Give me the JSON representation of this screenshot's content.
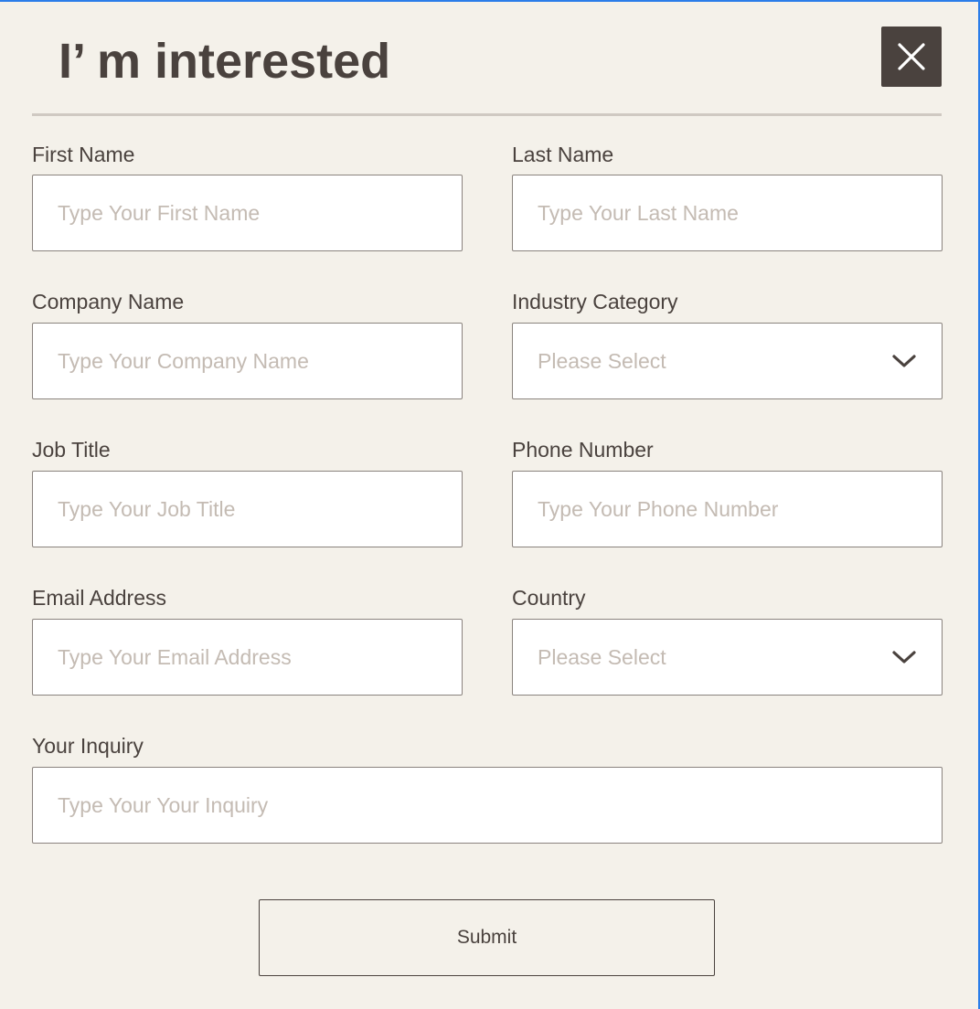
{
  "form": {
    "title": "I’ m interested",
    "close_icon": "close-icon",
    "submit_label": "Submit",
    "fields": {
      "first_name": {
        "label": "First Name",
        "placeholder": "Type Your First Name",
        "value": ""
      },
      "last_name": {
        "label": "Last Name",
        "placeholder": "Type Your Last Name",
        "value": ""
      },
      "company_name": {
        "label": "Company Name",
        "placeholder": "Type Your Company Name",
        "value": ""
      },
      "industry_category": {
        "label": "Industry Category",
        "selected": "Please Select",
        "icon": "chevron-down-icon"
      },
      "job_title": {
        "label": "Job Title",
        "placeholder": "Type Your Job Title",
        "value": ""
      },
      "phone_number": {
        "label": "Phone Number",
        "placeholder": "Type Your Phone Number",
        "value": ""
      },
      "email_address": {
        "label": "Email Address",
        "placeholder": "Type Your Email Address",
        "value": ""
      },
      "country": {
        "label": "Country",
        "selected": "Please Select",
        "icon": "chevron-down-icon"
      },
      "your_inquiry": {
        "label": "Your Inquiry",
        "placeholder": "Type Your Your Inquiry",
        "value": ""
      }
    }
  },
  "colors": {
    "background": "#f4f1ea",
    "text": "#4a423e",
    "placeholder": "#c4bbb3",
    "border": "#8a837e",
    "divider": "#cfc9c2",
    "frame_accent": "#2b7de9"
  }
}
